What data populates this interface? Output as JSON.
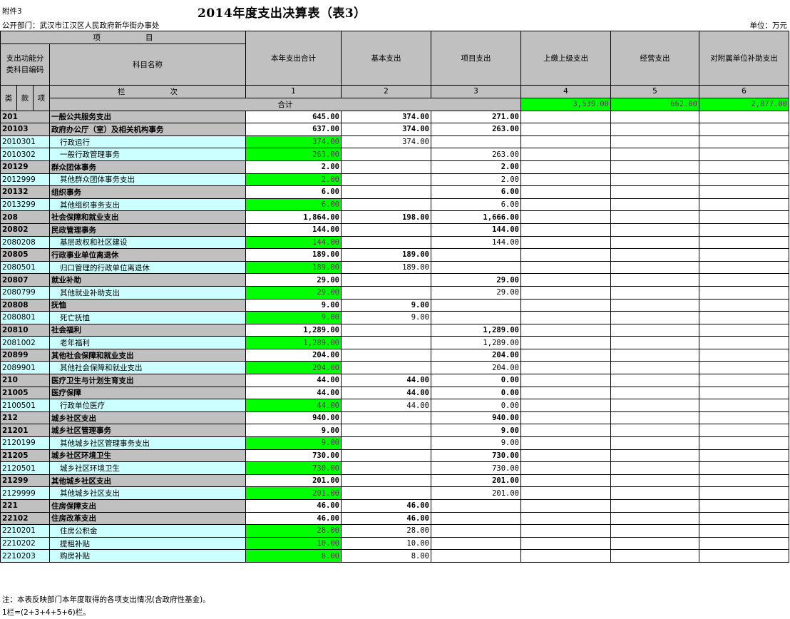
{
  "header": {
    "attachment": "附件3",
    "title": "2014年度支出决算表（表3）",
    "department": "公开部门：武汉市江汉区人民政府新华街办事处",
    "unit": "单位：万元"
  },
  "columns": {
    "item": "项　　　　　　目",
    "code": "支出功能分类科目编码",
    "name": "科目名称",
    "lei": "类",
    "kuan": "款",
    "xiang": "项",
    "lanci": "栏　　　　　　次",
    "total": "本年支出合计",
    "basic": "基本支出",
    "project": "项目支出",
    "upper": "上缴上级支出",
    "business": "经营支出",
    "subsidy": "对附属单位补助支出",
    "nums": [
      "1",
      "2",
      "3",
      "4",
      "5",
      "6"
    ]
  },
  "total_row": {
    "label": "合计",
    "total": "3,539.00",
    "basic": "662.00",
    "project": "2,877.00"
  },
  "rows": [
    {
      "code": "201",
      "name": "一般公共服务支出",
      "total": "645.00",
      "basic": "374.00",
      "project": "271.00",
      "level": "lei"
    },
    {
      "code": "20103",
      "name": "政府办公厅（室）及相关机构事务",
      "total": "637.00",
      "basic": "374.00",
      "project": "263.00",
      "level": "kuan"
    },
    {
      "code": "2010301",
      "name": "行政运行",
      "total": "374.00",
      "basic": "374.00",
      "project": "",
      "level": "xiang"
    },
    {
      "code": "2010302",
      "name": "一般行政管理事务",
      "total": "263.00",
      "basic": "",
      "project": "263.00",
      "level": "xiang"
    },
    {
      "code": "20129",
      "name": "群众团体事务",
      "total": "2.00",
      "basic": "",
      "project": "2.00",
      "level": "kuan"
    },
    {
      "code": "2012999",
      "name": "其他群众团体事务支出",
      "total": "2.00",
      "basic": "",
      "project": "2.00",
      "level": "xiang"
    },
    {
      "code": "20132",
      "name": "组织事务",
      "total": "6.00",
      "basic": "",
      "project": "6.00",
      "level": "kuan"
    },
    {
      "code": "2013299",
      "name": "其他组织事务支出",
      "total": "6.00",
      "basic": "",
      "project": "6.00",
      "level": "xiang"
    },
    {
      "code": "208",
      "name": "社会保障和就业支出",
      "total": "1,864.00",
      "basic": "198.00",
      "project": "1,666.00",
      "level": "lei"
    },
    {
      "code": "20802",
      "name": "民政管理事务",
      "total": "144.00",
      "basic": "",
      "project": "144.00",
      "level": "kuan"
    },
    {
      "code": "2080208",
      "name": "基层政权和社区建设",
      "total": "144.00",
      "basic": "",
      "project": "144.00",
      "level": "xiang"
    },
    {
      "code": "20805",
      "name": "行政事业单位离退休",
      "total": "189.00",
      "basic": "189.00",
      "project": "",
      "level": "kuan"
    },
    {
      "code": "2080501",
      "name": "归口管理的行政单位离退休",
      "total": "189.00",
      "basic": "189.00",
      "project": "",
      "level": "xiang"
    },
    {
      "code": "20807",
      "name": "就业补助",
      "total": "29.00",
      "basic": "",
      "project": "29.00",
      "level": "kuan"
    },
    {
      "code": "2080799",
      "name": "其他就业补助支出",
      "total": "29.00",
      "basic": "",
      "project": "29.00",
      "level": "xiang"
    },
    {
      "code": "20808",
      "name": "抚恤",
      "total": "9.00",
      "basic": "9.00",
      "project": "",
      "level": "kuan"
    },
    {
      "code": "2080801",
      "name": "死亡抚恤",
      "total": "9.00",
      "basic": "9.00",
      "project": "",
      "level": "xiang"
    },
    {
      "code": "20810",
      "name": "社会福利",
      "total": "1,289.00",
      "basic": "",
      "project": "1,289.00",
      "level": "kuan"
    },
    {
      "code": "2081002",
      "name": "老年福利",
      "total": "1,289.00",
      "basic": "",
      "project": "1,289.00",
      "level": "xiang"
    },
    {
      "code": "20899",
      "name": "其他社会保障和就业支出",
      "total": "204.00",
      "basic": "",
      "project": "204.00",
      "level": "kuan"
    },
    {
      "code": "2089901",
      "name": "其他社会保障和就业支出",
      "total": "204.00",
      "basic": "",
      "project": "204.00",
      "level": "xiang"
    },
    {
      "code": "210",
      "name": "医疗卫生与计划生育支出",
      "total": "44.00",
      "basic": "44.00",
      "project": "0.00",
      "level": "lei"
    },
    {
      "code": "21005",
      "name": "医疗保障",
      "total": "44.00",
      "basic": "44.00",
      "project": "0.00",
      "level": "kuan"
    },
    {
      "code": "2100501",
      "name": "行政单位医疗",
      "total": "44.00",
      "basic": "44.00",
      "project": "0.00",
      "level": "xiang"
    },
    {
      "code": "212",
      "name": "城乡社区支出",
      "total": "940.00",
      "basic": "",
      "project": "940.00",
      "level": "lei"
    },
    {
      "code": "21201",
      "name": "城乡社区管理事务",
      "total": "9.00",
      "basic": "",
      "project": "9.00",
      "level": "kuan"
    },
    {
      "code": "2120199",
      "name": "其他城乡社区管理事务支出",
      "total": "9.00",
      "basic": "",
      "project": "9.00",
      "level": "xiang"
    },
    {
      "code": "21205",
      "name": "城乡社区环境卫生",
      "total": "730.00",
      "basic": "",
      "project": "730.00",
      "level": "kuan"
    },
    {
      "code": "2120501",
      "name": "城乡社区环境卫生",
      "total": "730.00",
      "basic": "",
      "project": "730.00",
      "level": "xiang"
    },
    {
      "code": "21299",
      "name": "其他城乡社区支出",
      "total": "201.00",
      "basic": "",
      "project": "201.00",
      "level": "kuan"
    },
    {
      "code": "2129999",
      "name": "其他城乡社区支出",
      "total": "201.00",
      "basic": "",
      "project": "201.00",
      "level": "xiang"
    },
    {
      "code": "221",
      "name": "住房保障支出",
      "total": "46.00",
      "basic": "46.00",
      "project": "",
      "level": "lei"
    },
    {
      "code": "22102",
      "name": "住房改革支出",
      "total": "46.00",
      "basic": "46.00",
      "project": "",
      "level": "kuan"
    },
    {
      "code": "2210201",
      "name": "住房公积金",
      "total": "28.00",
      "basic": "28.00",
      "project": "",
      "level": "xiang"
    },
    {
      "code": "2210202",
      "name": "提租补贴",
      "total": "10.00",
      "basic": "10.00",
      "project": "",
      "level": "xiang"
    },
    {
      "code": "2210203",
      "name": "购房补贴",
      "total": "8.00",
      "basic": "8.00",
      "project": "",
      "level": "xiang"
    }
  ],
  "notes": [
    "注：本表反映部门本年度取得的各项支出情况(含政府性基金)。",
    "1栏=(2+3+4+5+6)栏。"
  ],
  "colors": {
    "header_grey": "#c0c0c0",
    "cyan": "#ccffff",
    "green": "#00ff00"
  }
}
